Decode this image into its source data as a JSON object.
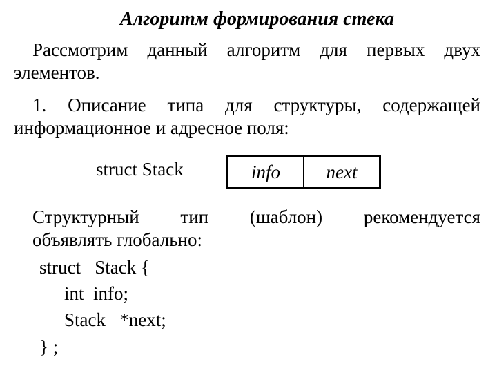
{
  "title": "Алгоритм формирования  стека",
  "paragraphs": {
    "intro": "Рассмотрим данный алгоритм для первых двух элементов.",
    "step1": "1. Описание типа для структуры, содержащей информационное и адресное поля:",
    "note_line1": "Структурный тип (шаблон) рекомендуется",
    "note_line2": "объявлять глобально:"
  },
  "diagram": {
    "label": "struct  Stack",
    "fields": [
      "info",
      "next"
    ]
  },
  "code": {
    "lines": [
      "struct   Stack {",
      "int  info;",
      "Stack   *next;",
      "} ;"
    ]
  }
}
